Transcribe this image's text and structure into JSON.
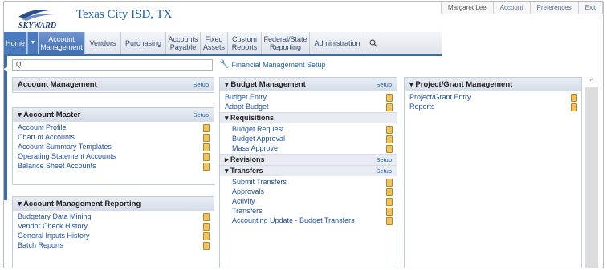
{
  "header": {
    "district_name": "Texas City ISD, TX",
    "user_name": "Margaret Lee",
    "account_link": "Account",
    "preferences_link": "Preferences",
    "exit_link": "Exit"
  },
  "nav": {
    "home": "Home",
    "account_management": "Account Management",
    "vendors": "Vendors",
    "purchasing": "Purchasing",
    "accounts_payable": "Accounts Payable",
    "fixed_assets": "Fixed Assets",
    "custom_reports": "Custom Reports",
    "federal_state_reporting": "Federal/State Reporting",
    "administration": "Administration"
  },
  "search": {
    "value": "Q|"
  },
  "financial_setup": "Financial Management Setup",
  "panels": {
    "account_management": {
      "title": "Account Management",
      "setup": "Setup"
    },
    "account_master": {
      "title": "Account Master",
      "setup": "Setup",
      "items": [
        "Account Profile",
        "Chart of Accounts",
        "Account Summary Templates",
        "Operating Statement Accounts",
        "Balance Sheet Accounts"
      ]
    },
    "reporting": {
      "title": "Account Management Reporting",
      "items": [
        "Budgetary Data Mining",
        "Vendor Check History",
        "General Inputs History",
        "Batch Reports"
      ]
    },
    "budget": {
      "title": "Budget Management",
      "setup": "Setup",
      "items": [
        "Budget Entry",
        "Adopt Budget"
      ],
      "requisitions": {
        "title": "Requisitions",
        "items": [
          "Budget Request",
          "Budget Approval",
          "Mass Approve"
        ]
      },
      "revisions": {
        "title": "Revisions",
        "setup": "Setup"
      },
      "transfers": {
        "title": "Transfers",
        "setup": "Setup",
        "items": [
          "Submit Transfers",
          "Approvals",
          "Activity",
          "Transfers",
          "Accounting Update - Budget Transfers"
        ]
      }
    },
    "project": {
      "title": "Project/Grant Management",
      "items": [
        "Project/Grant Entry",
        "Reports"
      ]
    }
  },
  "icons": {
    "favorite": "favorite-icon",
    "search": "search-icon",
    "wrench": "wrench-icon"
  }
}
